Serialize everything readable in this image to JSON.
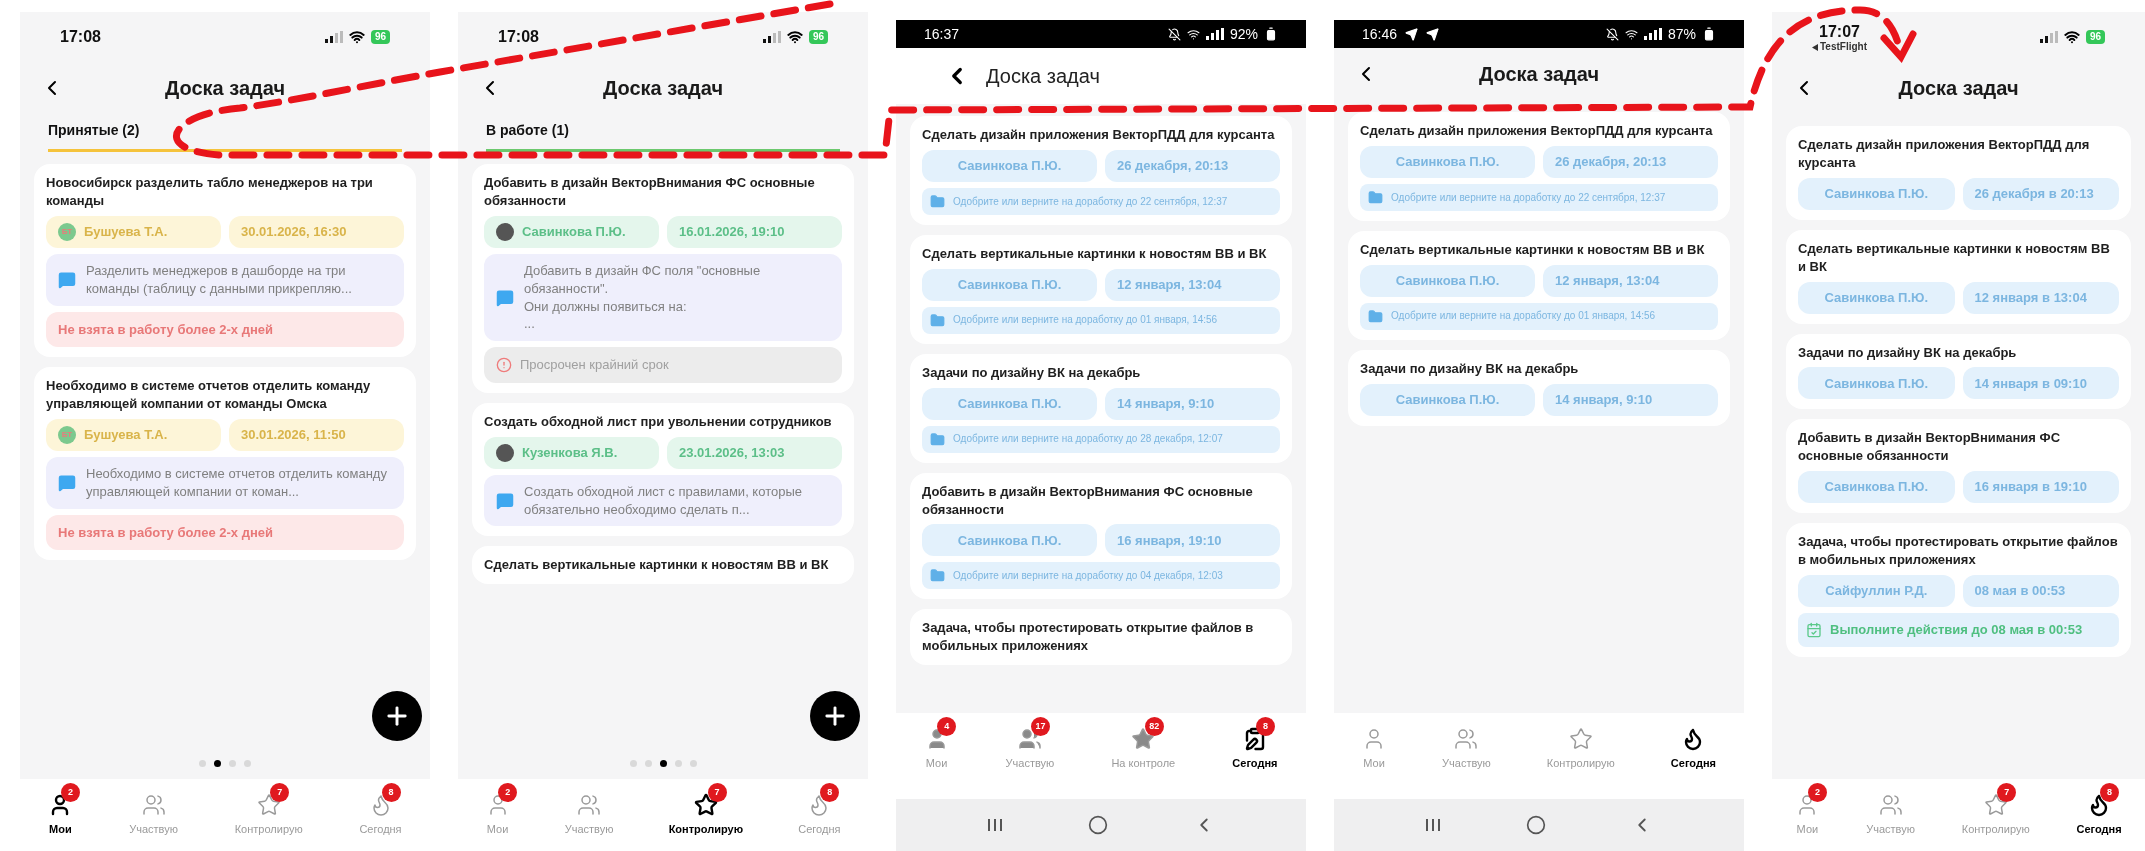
{
  "phones": [
    {
      "status_bar": {
        "kind": "ios",
        "time": "17:08",
        "battery": "96"
      },
      "header": {
        "kind": "centered",
        "title": "Доска задач"
      },
      "tab": {
        "label": "Принятые (2)",
        "kind": "accepted"
      },
      "cards": [
        {
          "kind": "accepted",
          "title": "Новосибирск разделить табло менеджеров на три команды",
          "assignee": {
            "name": "Бушуева Т.А.",
            "avatar": {
              "kind": "initials",
              "text": "БТ"
            }
          },
          "date": "30.01.2026, 16:30",
          "note": {
            "kind": "comment",
            "text": "Разделить менеджеров в дашборде на три команды (таблицу с данными прикрепляю..."
          },
          "alert": {
            "kind": "stale",
            "text": "Не взята в работу более 2-х дней"
          }
        },
        {
          "kind": "accepted",
          "title": "Необходимо в системе отчетов отделить команду управляющей компании от команды Омска",
          "assignee": {
            "name": "Бушуева Т.А.",
            "avatar": {
              "kind": "initials",
              "text": "БТ"
            }
          },
          "date": "30.01.2026, 11:50",
          "note": {
            "kind": "comment",
            "text": "Необходимо в системе отчетов отделить команду управляющей компании от коман..."
          },
          "alert": {
            "kind": "stale",
            "text": "Не взята в работу более 2-х дней"
          }
        }
      ],
      "fab": true,
      "page_dots": [
        {
          "selected": false
        },
        {
          "selected": true
        },
        {
          "selected": false
        },
        {
          "selected": false
        }
      ],
      "nav": [
        {
          "label": "Мои",
          "kind": "person",
          "badge": "2",
          "selected": true
        },
        {
          "label": "Участвую",
          "kind": "people",
          "selected": false
        },
        {
          "label": "Контролирую",
          "kind": "star",
          "badge": "7",
          "selected": false
        },
        {
          "label": "Сегодня",
          "kind": "flame",
          "badge": "8",
          "selected": false
        }
      ],
      "system_nav": false
    },
    {
      "status_bar": {
        "kind": "ios",
        "time": "17:08",
        "battery": "96"
      },
      "header": {
        "kind": "centered",
        "title": "Доска задач"
      },
      "tab": {
        "label": "В работе (1)",
        "kind": "in_progress"
      },
      "cards": [
        {
          "kind": "in_progress",
          "title": "Добавить в дизайн ВекторВнимания ФС основные обязанности",
          "assignee": {
            "name": "Савинкова П.Ю.",
            "avatar": {
              "kind": "photo"
            }
          },
          "date": "16.01.2026, 19:10",
          "note": {
            "kind": "comment",
            "text": "Добавить в дизайн ФС поля \"основные обязанности\".\nОни должны появиться на:\n..."
          },
          "alert": {
            "kind": "overdue",
            "text": "Просрочен крайний срок"
          }
        },
        {
          "kind": "in_progress",
          "title": "Создать обходной лист при увольнении сотрудников",
          "assignee": {
            "name": "Кузенкова Я.В.",
            "avatar": {
              "kind": "photo"
            }
          },
          "date": "23.01.2026, 13:03",
          "note": {
            "kind": "comment",
            "text": "Создать обходной лист с правилами, которые обязательно необходимо сделать п..."
          }
        },
        {
          "kind": "in_progress",
          "title": "Сделать вертикальные картинки к новостям ВВ и ВК"
        }
      ],
      "fab": true,
      "page_dots": [
        {
          "selected": false
        },
        {
          "selected": false
        },
        {
          "selected": true
        },
        {
          "selected": false
        },
        {
          "selected": false
        }
      ],
      "nav": [
        {
          "label": "Мои",
          "kind": "person",
          "badge": "2",
          "selected": false
        },
        {
          "label": "Участвую",
          "kind": "people",
          "selected": false
        },
        {
          "label": "Контролирую",
          "kind": "star",
          "badge": "7",
          "selected": true
        },
        {
          "label": "Сегодня",
          "kind": "flame",
          "badge": "8",
          "selected": false
        }
      ],
      "system_nav": false
    },
    {
      "status_bar": {
        "kind": "android",
        "time": "16:37",
        "battery": "92%"
      },
      "header": {
        "kind": "inline",
        "title": "Доска задач"
      },
      "cards": [
        {
          "kind": "review",
          "title": "Сделать дизайн приложения ВекторПДД для курсанта",
          "assignee": {
            "name": "Савинкова П.Ю."
          },
          "date": "26 декабря, 20:13",
          "note": {
            "kind": "approval",
            "text": "Одобрите или верните на доработку до 22 сентября, 12:37"
          }
        },
        {
          "kind": "review",
          "title": "Сделать вертикальные картинки к новостям ВВ и ВК",
          "assignee": {
            "name": "Савинкова П.Ю."
          },
          "date": "12 января, 13:04",
          "note": {
            "kind": "approval",
            "text": "Одобрите или верните на доработку до 01 января, 14:56"
          }
        },
        {
          "kind": "review",
          "title": "Задачи по дизайну ВК на декабрь",
          "assignee": {
            "name": "Савинкова П.Ю."
          },
          "date": "14 января, 9:10",
          "note": {
            "kind": "approval",
            "text": "Одобрите или верните на доработку до 28 декабря, 12:07"
          }
        },
        {
          "kind": "review",
          "title": "Добавить в дизайн ВекторВнимания ФС основные обязанности",
          "assignee": {
            "name": "Савинкова П.Ю."
          },
          "date": "16 января, 19:10",
          "note": {
            "kind": "approval",
            "text": "Одобрите или верните на доработку до 04 декабря, 12:03"
          }
        },
        {
          "kind": "review",
          "title": "Задача, чтобы протестировать открытие файлов в мобильных приложениях"
        }
      ],
      "fab": false,
      "nav": [
        {
          "label": "Мои",
          "kind": "silhouette",
          "badge": "4",
          "selected": false
        },
        {
          "label": "Участвую",
          "kind": "crowd",
          "badge": "17",
          "selected": false
        },
        {
          "label": "На контроле",
          "kind": "starfill",
          "badge": "82",
          "selected": false
        },
        {
          "label": "Сегодня",
          "kind": "clipboard",
          "badge": "8",
          "selected": true
        }
      ],
      "system_nav": true
    },
    {
      "status_bar": {
        "kind": "android",
        "time": "16:46",
        "notifications": [
          {
            "kind": "telegram"
          },
          {
            "kind": "telegram"
          }
        ],
        "battery": "87%"
      },
      "header": {
        "kind": "centered",
        "title": "Доска задач"
      },
      "cards": [
        {
          "kind": "review",
          "title": "Сделать дизайн приложения ВекторПДД для курсанта",
          "assignee": {
            "name": "Савинкова П.Ю."
          },
          "date": "26 декабря, 20:13",
          "note": {
            "kind": "approval",
            "text": "Одобрите или верните на доработку до 22 сентября, 12:37"
          }
        },
        {
          "kind": "review",
          "title": "Сделать вертикальные картинки к новостям ВВ и ВК",
          "assignee": {
            "name": "Савинкова П.Ю."
          },
          "date": "12 января, 13:04",
          "note": {
            "kind": "approval",
            "text": "Одобрите или верните на доработку до 01 января, 14:56"
          }
        },
        {
          "kind": "review",
          "title": "Задачи по дизайну ВК на декабрь",
          "assignee": {
            "name": "Савинкова П.Ю."
          },
          "date": "14 января, 9:10"
        }
      ],
      "fab": false,
      "nav": [
        {
          "label": "Мои",
          "kind": "person",
          "selected": false
        },
        {
          "label": "Участвую",
          "kind": "people",
          "selected": false
        },
        {
          "label": "Контролирую",
          "kind": "star",
          "selected": false
        },
        {
          "label": "Сегодня",
          "kind": "flame",
          "selected": true
        }
      ],
      "system_nav": true
    },
    {
      "status_bar": {
        "kind": "ios",
        "time": "17:07",
        "back_app": "TestFlight",
        "battery": "96"
      },
      "header": {
        "kind": "centered",
        "title": "Доска задач"
      },
      "cards": [
        {
          "kind": "review",
          "title": "Сделать дизайн приложения ВекторПДД для курсанта",
          "assignee": {
            "name": "Савинкова П.Ю."
          },
          "date": "26 декабря в 20:13"
        },
        {
          "kind": "review",
          "title": "Сделать вертикальные картинки к новостям ВВ и ВК",
          "assignee": {
            "name": "Савинкова П.Ю."
          },
          "date": "12 января в 13:04"
        },
        {
          "kind": "review",
          "title": "Задачи по дизайну ВК на декабрь",
          "assignee": {
            "name": "Савинкова П.Ю."
          },
          "date": "14 января в 09:10"
        },
        {
          "kind": "review",
          "title": "Добавить в дизайн ВекторВнимания ФС основные обязанности",
          "assignee": {
            "name": "Савинкова П.Ю."
          },
          "date": "16 января в 19:10"
        },
        {
          "kind": "review",
          "title": "Задача, чтобы протестировать открытие файлов в мобильных приложениях",
          "assignee": {
            "name": "Сайфуллин Р.Д."
          },
          "date": "08 мая в 00:53",
          "note": {
            "kind": "action",
            "text": "Выполните действия до 08 мая в 00:53"
          }
        }
      ],
      "fab": false,
      "nav": [
        {
          "label": "Мои",
          "kind": "person",
          "badge": "2",
          "selected": false
        },
        {
          "label": "Участвую",
          "kind": "people",
          "selected": false
        },
        {
          "label": "Контролирую",
          "kind": "star",
          "badge": "7",
          "selected": false
        },
        {
          "label": "Сегодня",
          "kind": "flame",
          "badge": "8",
          "selected": true
        }
      ],
      "system_nav": false
    }
  ]
}
